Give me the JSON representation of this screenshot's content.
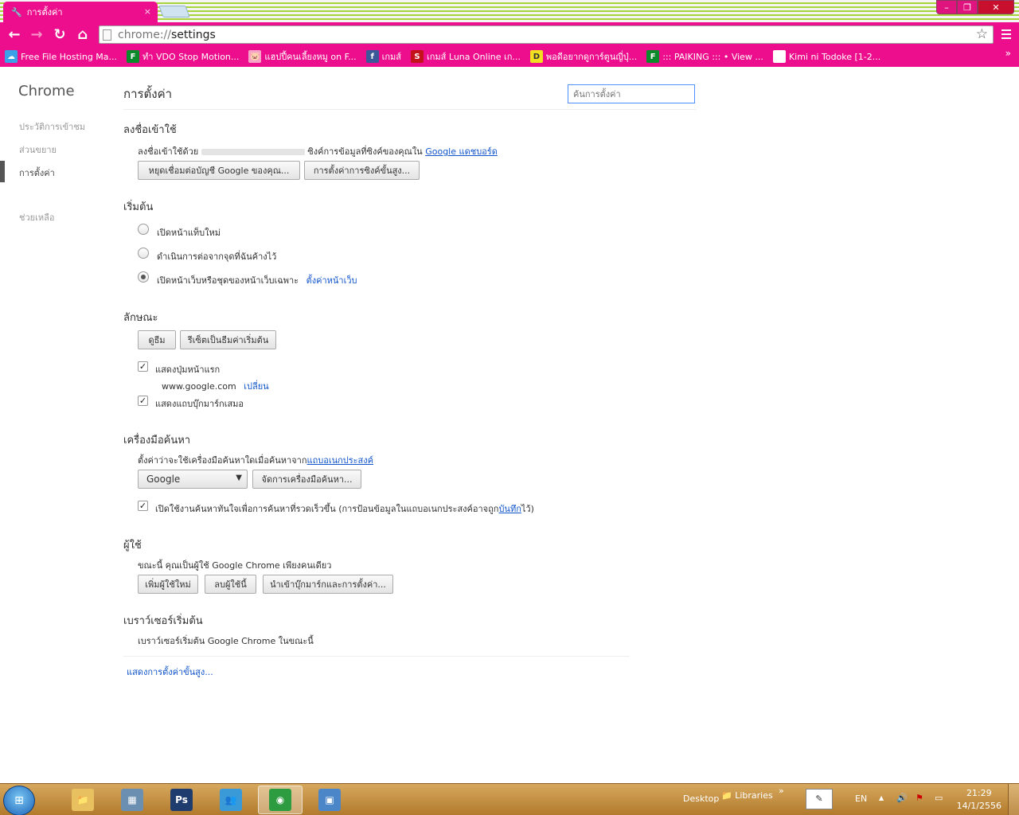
{
  "tab": {
    "title": "การตั้งค่า",
    "icon": "wrench-icon",
    "close": "×"
  },
  "window_controls": {
    "minimize": "–",
    "maximize": "❐",
    "close": "✕"
  },
  "omnibox": {
    "scheme": "chrome://",
    "host": "settings"
  },
  "bookmarks": [
    {
      "label": "Free File Hosting Ma...",
      "icon": "cloud-icon",
      "color": "#3aa0e8",
      "glyph": "☁"
    },
    {
      "label": "ทำ VDO Stop Motion...",
      "icon": "f-logo-icon",
      "color": "#0a8a2a",
      "glyph": "F"
    },
    {
      "label": "แฮปปี้คนเลี้ยงหมู on F...",
      "icon": "pig-icon",
      "color": "#f5a3c7",
      "glyph": "🐷"
    },
    {
      "label": "เกมส์",
      "icon": "facebook-icon",
      "color": "#3b5998",
      "glyph": "f"
    },
    {
      "label": "เกมส์ Luna Online เก...",
      "icon": "s-logo-icon",
      "color": "#c4121a",
      "glyph": "S"
    },
    {
      "label": "พอดีอยากดูการ์ตูนญี่ปุ่...",
      "icon": "d-logo-icon",
      "color": "#f0e020",
      "glyph": "D"
    },
    {
      "label": "::: PAIKING ::: • View ...",
      "icon": "f-logo-icon",
      "color": "#0a8a2a",
      "glyph": "F"
    },
    {
      "label": "Kimi ni Todoke [1-2...",
      "icon": "page-icon",
      "color": "#ffffff",
      "glyph": ""
    }
  ],
  "bookmarks_more": "»",
  "sidebar": {
    "title": "Chrome",
    "items": [
      {
        "label": "ประวัติการเข้าชม"
      },
      {
        "label": "ส่วนขยาย"
      },
      {
        "label": "การตั้งค่า"
      },
      {
        "label": "ช่วยเหลือ"
      }
    ]
  },
  "main": {
    "title": "การตั้งค่า",
    "search_placeholder": "ค้นการตั้งค่า",
    "signin": {
      "heading": "ลงชื่อเข้าใช้",
      "text_prefix": "ลงชื่อเข้าใช้ด้วย",
      "text_suffix": "ซิงค์การข้อมูลที่ซิงค์ของคุณใน",
      "link": "Google แดชบอร์ด",
      "disconnect_button": "หยุดเชื่อมต่อบัญชี Google ของคุณ...",
      "advanced_sync_button": "การตั้งค่าการซิงค์ขั้นสูง..."
    },
    "startup": {
      "heading": "เริ่มต้น",
      "options": [
        {
          "label": "เปิดหน้าแท็บใหม่",
          "selected": false
        },
        {
          "label": "ดำเนินการต่อจากจุดที่ฉันค้างไว้",
          "selected": false
        },
        {
          "label": "เปิดหน้าเว็บหรือชุดของหน้าเว็บเฉพาะ",
          "selected": true
        }
      ],
      "set_pages_link": "ตั้งค่าหน้าเว็บ"
    },
    "appearance": {
      "heading": "ลักษณะ",
      "themes_button": "ดูธีม",
      "reset_theme_button": "รีเซ็ตเป็นธีมค่าเริ่มต้น",
      "show_home_label": "แสดงปุ่มหน้าแรก",
      "show_home_checked": true,
      "home_url": "www.google.com",
      "change_link": "เปลี่ยน",
      "bookmarks_bar_label": "แสดงแถบบุ๊กมาร์กเสมอ",
      "bookmarks_bar_checked": true
    },
    "search": {
      "heading": "เครื่องมือค้นหา",
      "text": "ตั้งค่าว่าจะใช้เครื่องมือค้นหาใดเมื่อค้นหาจาก",
      "omnibox_link": "แถบอเนกประสงค์",
      "engine": "Google",
      "manage_button": "จัดการเครื่องมือค้นหา...",
      "instant_label_prefix": "เปิดใช้งานค้นหาทันใจเพื่อการค้นหาที่รวดเร็วขึ้น (การป้อนข้อมูลในแถบอเนกประสงค์อาจถูก",
      "instant_link": "บันทึก",
      "instant_label_suffix": "ไว้)",
      "instant_checked": true
    },
    "users": {
      "heading": "ผู้ใช้",
      "text": "ขณะนี้ คุณเป็นผู้ใช้ Google Chrome เพียงคนเดียว",
      "add_button": "เพิ่มผู้ใช้ใหม่",
      "delete_button": "ลบผู้ใช้นี้",
      "import_button": "นำเข้าบุ๊กมาร์กและการตั้งค่า..."
    },
    "default_browser": {
      "heading": "เบราว์เซอร์เริ่มต้น",
      "text": "เบราว์เซอร์เริ่มต้น Google Chrome ในขณะนี้"
    },
    "advanced_link": "แสดงการตั้งค่าขั้นสูง..."
  },
  "taskbar": {
    "start_glyph": "⊞",
    "apps": [
      {
        "name": "explorer",
        "glyph": "📁",
        "color": "#e8c060"
      },
      {
        "name": "calculator",
        "glyph": "▦",
        "color": "#6a8fb0"
      },
      {
        "name": "photoshop",
        "glyph": "Ps",
        "color": "#1f3c6e"
      },
      {
        "name": "messenger",
        "glyph": "👥",
        "color": "#3a9ad8"
      },
      {
        "name": "chrome",
        "glyph": "◉",
        "color": "#2d9b3f"
      },
      {
        "name": "control-panel",
        "glyph": "▣",
        "color": "#4a86c8"
      }
    ],
    "desktop_label": "Desktop",
    "libraries_label": "Libraries",
    "toolbar_more": "»",
    "language": "EN",
    "tray_expand": "▲",
    "volume_glyph": "🔊",
    "time": "21:29",
    "date": "14/1/2556"
  }
}
